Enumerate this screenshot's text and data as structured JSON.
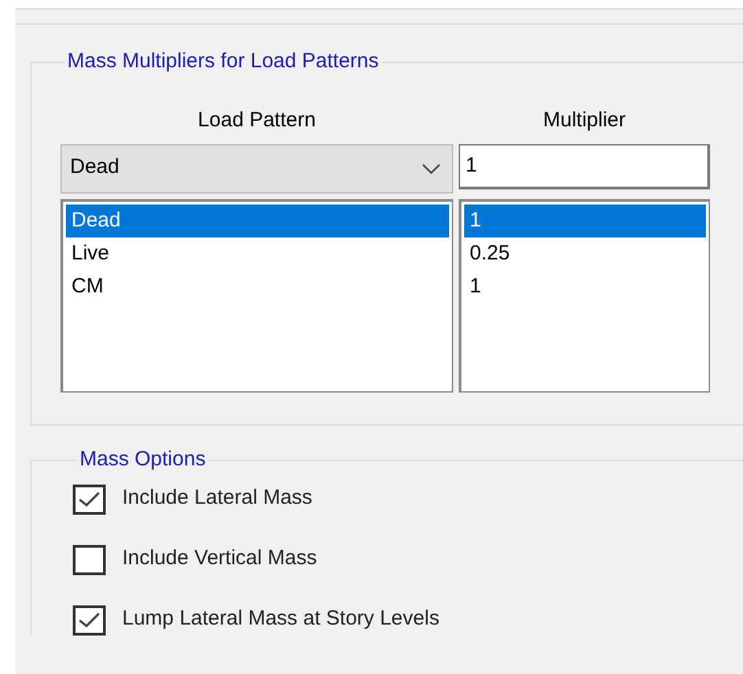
{
  "multipliers_group": {
    "title": "Mass Multipliers for Load Patterns",
    "columns": [
      "Load Pattern",
      "Multiplier"
    ],
    "pattern_dropdown": {
      "value": "Dead"
    },
    "multiplier_field": {
      "value": "1"
    },
    "rows": [
      {
        "pattern": "Dead",
        "multiplier": "1",
        "selected": true
      },
      {
        "pattern": "Live",
        "multiplier": "0.25",
        "selected": false
      },
      {
        "pattern": "CM",
        "multiplier": "1",
        "selected": false
      }
    ]
  },
  "options_group": {
    "title": "Mass Options",
    "options": [
      {
        "label": "Include Lateral Mass",
        "checked": true
      },
      {
        "label": "Include Vertical Mass",
        "checked": false
      },
      {
        "label": "Lump Lateral Mass at Story Levels",
        "checked": true
      }
    ]
  }
}
